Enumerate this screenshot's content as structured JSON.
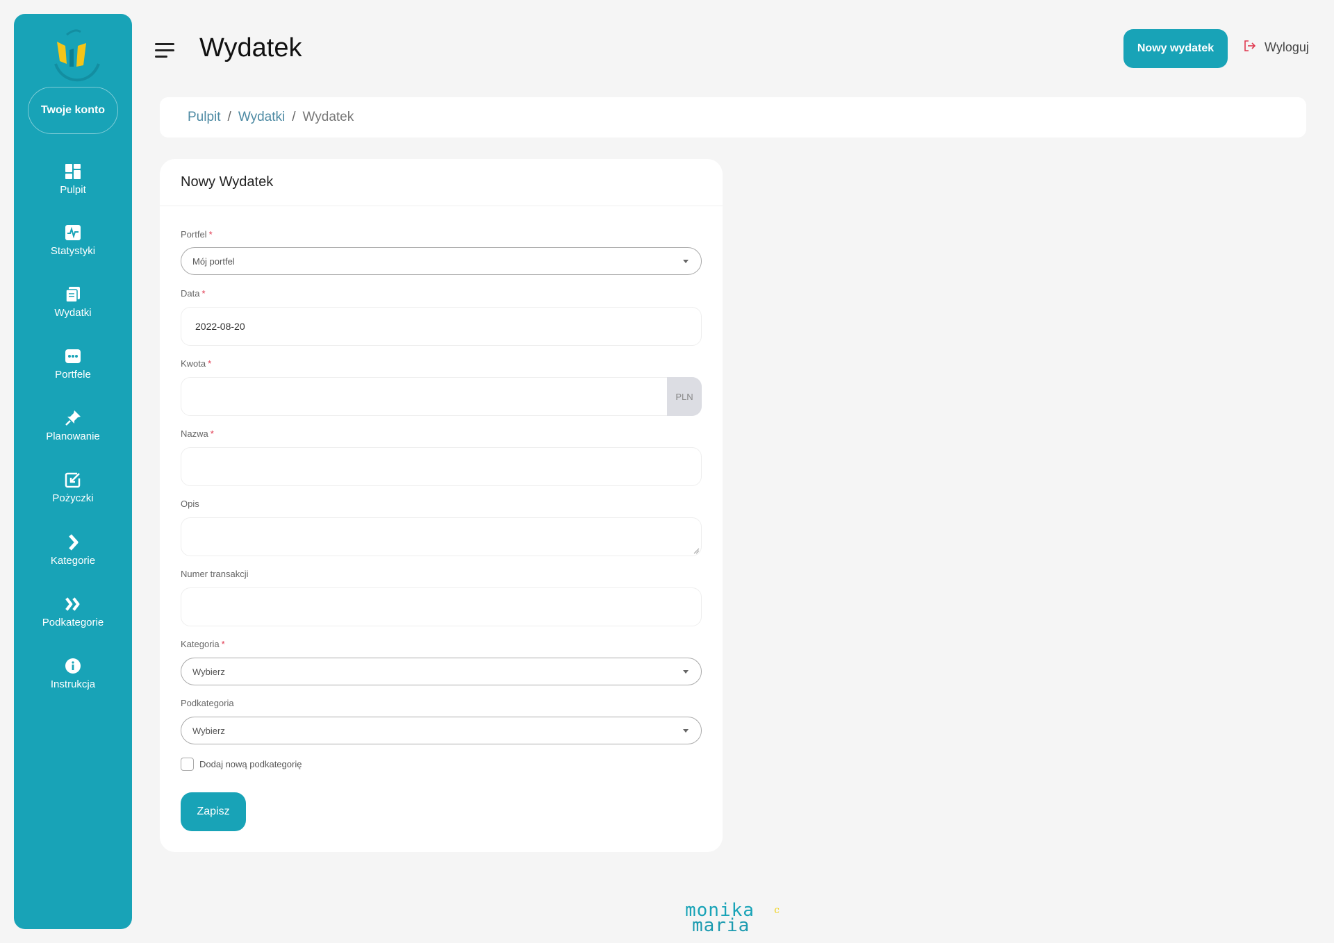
{
  "sidebar": {
    "account_label": "Twoje konto",
    "items": [
      {
        "label": "Pulpit",
        "icon": "dashboard-icon"
      },
      {
        "label": "Statystyki",
        "icon": "stats-icon"
      },
      {
        "label": "Wydatki",
        "icon": "expenses-icon"
      },
      {
        "label": "Portfele",
        "icon": "wallet-icon"
      },
      {
        "label": "Planowanie",
        "icon": "pin-icon"
      },
      {
        "label": "Pożyczki",
        "icon": "edit-icon"
      },
      {
        "label": "Kategorie",
        "icon": "chevron-right-icon"
      },
      {
        "label": "Podkategorie",
        "icon": "double-chevron-right-icon"
      },
      {
        "label": "Instrukcja",
        "icon": "info-icon"
      }
    ]
  },
  "header": {
    "title": "Wydatek",
    "new_button": "Nowy wydatek",
    "logout": "Wyloguj"
  },
  "breadcrumb": {
    "items": [
      "Pulpit",
      "Wydatki",
      "Wydatek"
    ]
  },
  "form": {
    "title": "Nowy Wydatek",
    "wallet": {
      "label": "Portfel",
      "value": "Mój portfel"
    },
    "date": {
      "label": "Data",
      "value": "2022-08-20"
    },
    "amount": {
      "label": "Kwota",
      "value": "",
      "currency": "PLN"
    },
    "name": {
      "label": "Nazwa",
      "value": ""
    },
    "description": {
      "label": "Opis",
      "value": ""
    },
    "transaction_number": {
      "label": "Numer transakcji",
      "value": ""
    },
    "category": {
      "label": "Kategoria",
      "value": "Wybierz"
    },
    "subcategory": {
      "label": "Podkategoria",
      "value": "Wybierz"
    },
    "add_subcategory": {
      "label": "Dodaj nową podkategorię",
      "checked": false
    },
    "required_mark": "*",
    "save_button": "Zapisz"
  },
  "footer": {
    "line1_a": "monika",
    "line2": "maria",
    "mark": "c"
  },
  "colors": {
    "accent": "#18a3b7",
    "background": "#f5f5f5",
    "required": "#e0384f",
    "logo_yellow": "#f0d21a"
  }
}
